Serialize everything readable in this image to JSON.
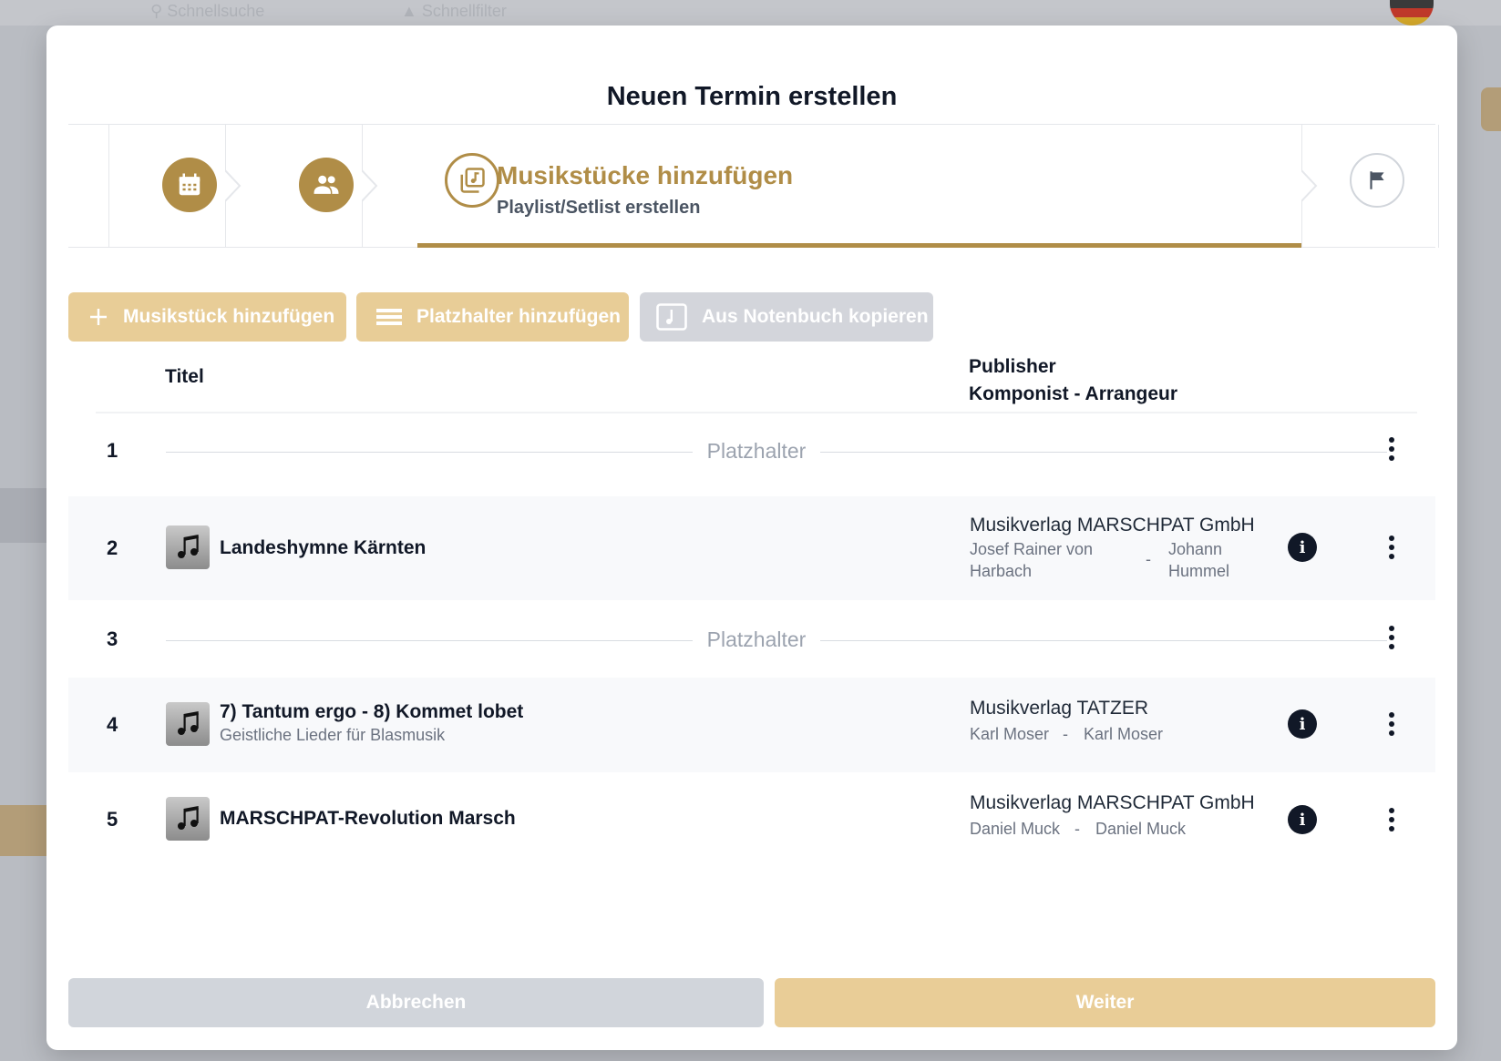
{
  "background": {
    "search_label": "Schnellsuche",
    "filter_label": "Schnellfilter"
  },
  "modal": {
    "title": "Neuen Termin erstellen"
  },
  "stepper": {
    "steps": [
      {
        "icon": "calendar-icon",
        "state": "done"
      },
      {
        "icon": "people-icon",
        "state": "done"
      },
      {
        "icon": "music-library-icon",
        "state": "active",
        "title": "Musikstücke hinzufügen",
        "subtitle": "Playlist/Setlist erstellen"
      },
      {
        "icon": "flag-icon",
        "state": "pending"
      }
    ]
  },
  "actions": {
    "add_piece": "Musikstück hinzufügen",
    "add_placeholder": "Platzhalter hinzufügen",
    "copy_from_book": "Aus Notenbuch kopieren"
  },
  "table": {
    "col_title": "Titel",
    "col_publisher": "Publisher",
    "col_composer": "Komponist - Arrangeur",
    "rows": [
      {
        "num": "1",
        "type": "placeholder",
        "label": "Platzhalter"
      },
      {
        "num": "2",
        "type": "piece",
        "title": "Landeshymne Kärnten",
        "subtitle": "",
        "publisher": "Musikverlag MARSCHPAT GmbH",
        "composer": "Josef Rainer von Harbach",
        "arranger": "Johann Hummel"
      },
      {
        "num": "3",
        "type": "placeholder",
        "label": "Platzhalter"
      },
      {
        "num": "4",
        "type": "piece",
        "title": "7) Tantum ergo - 8) Kommet lobet",
        "subtitle": "Geistliche Lieder für Blasmusik",
        "publisher": "Musikverlag TATZER",
        "composer": "Karl Moser",
        "arranger": "Karl Moser"
      },
      {
        "num": "5",
        "type": "piece",
        "title": "MARSCHPAT-Revolution Marsch",
        "subtitle": "",
        "publisher": "Musikverlag MARSCHPAT GmbH",
        "composer": "Daniel Muck",
        "arranger": "Daniel Muck"
      }
    ],
    "separator": "-"
  },
  "footer": {
    "cancel": "Abbrechen",
    "next": "Weiter"
  },
  "colors": {
    "accent": "#b08d47",
    "accent_light": "#e8cd97",
    "disabled_gray": "#d3d5db"
  }
}
